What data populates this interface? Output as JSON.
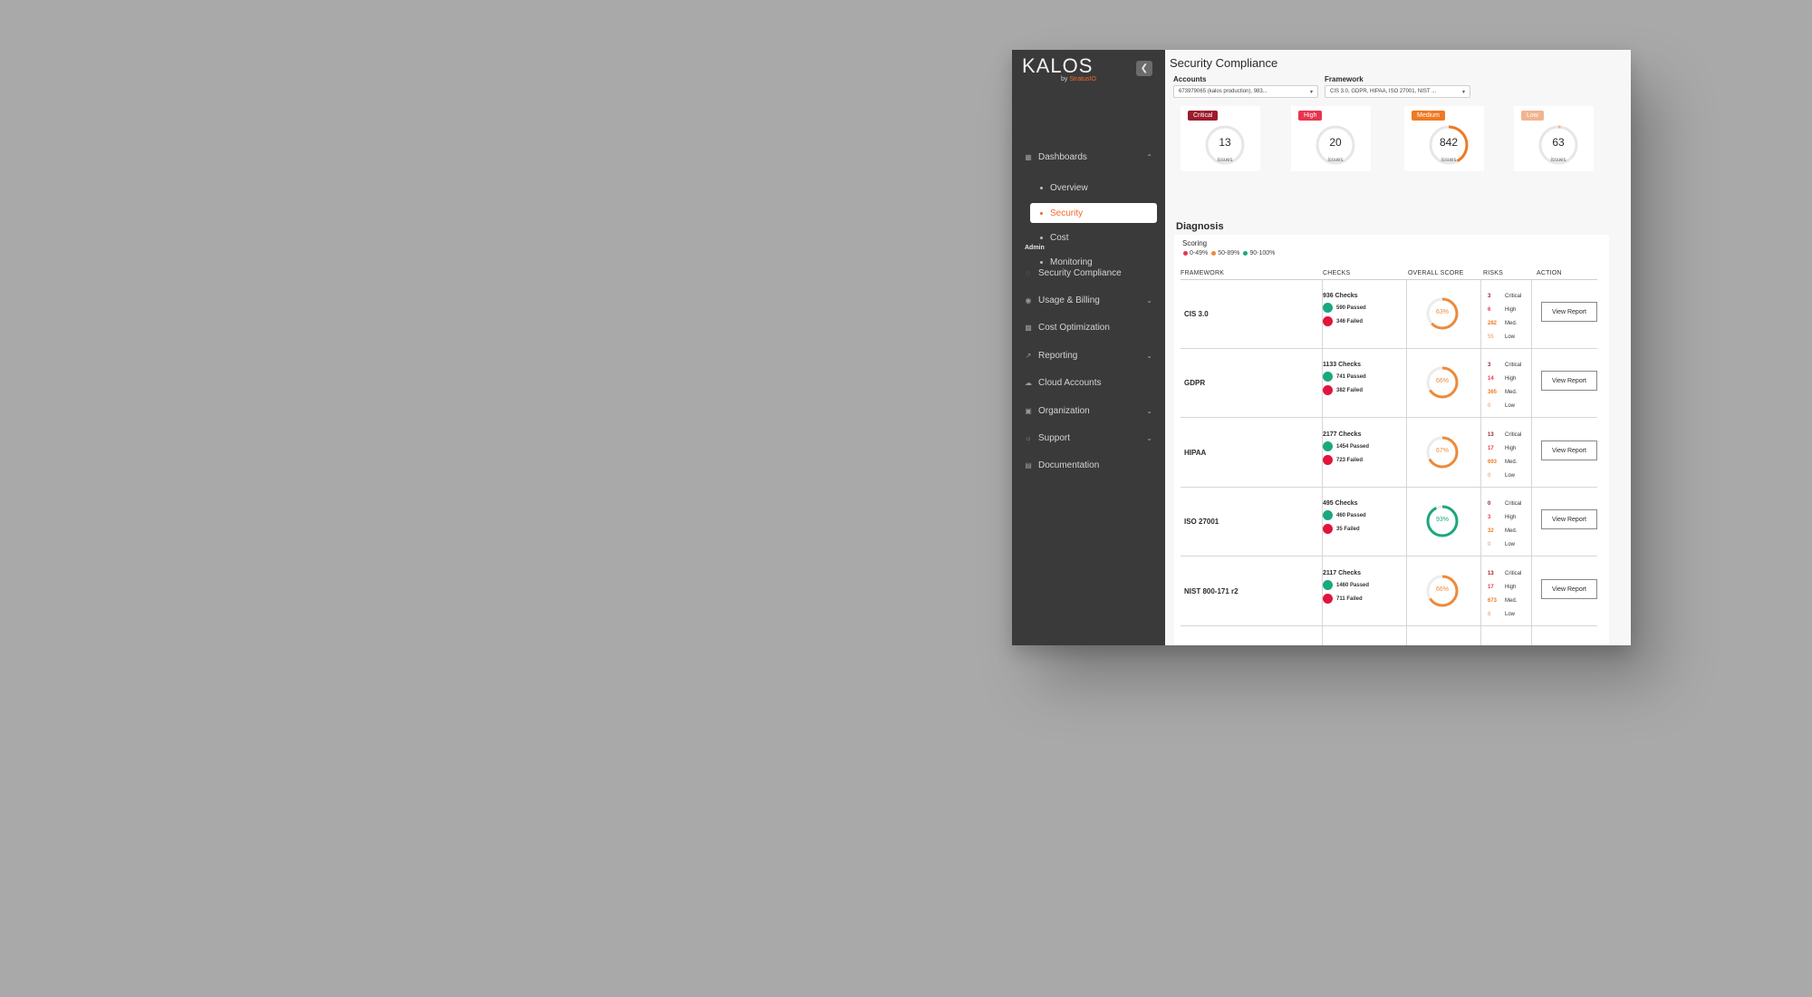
{
  "sidebar": {
    "logo": "KALOS",
    "logo_sub_prefix": "by ",
    "logo_sub_brand": "StratusIO",
    "dashboards_label": "Dashboards",
    "dashboard_items": [
      {
        "label": "Overview"
      },
      {
        "label": "Security"
      },
      {
        "label": "Cost"
      },
      {
        "label": "Monitoring"
      }
    ],
    "admin_label": "Admin",
    "admin_items": [
      {
        "label": "Security Compliance"
      },
      {
        "label": "Usage & Billing"
      },
      {
        "label": "Cost Optimization"
      },
      {
        "label": "Reporting"
      },
      {
        "label": "Cloud Accounts"
      },
      {
        "label": "Organization"
      },
      {
        "label": "Support"
      },
      {
        "label": "Documentation"
      }
    ]
  },
  "page": {
    "title": "Security Compliance",
    "accounts_label": "Accounts",
    "accounts_value": "673979065   (kalos production), 983...",
    "framework_label": "Framework",
    "framework_value": "CIS 3.0, GDPR, HIPAA, ISO 27001, NIST ..."
  },
  "severity": [
    {
      "label": "Critical",
      "count": "13",
      "unit": "issues",
      "color": "#9b1c2b",
      "fraction": 0.0
    },
    {
      "label": "High",
      "count": "20",
      "unit": "issues",
      "color": "#e8344e",
      "fraction": 0.0
    },
    {
      "label": "Medium",
      "count": "842",
      "unit": "issues",
      "color": "#ee7a22",
      "fraction": 0.42
    },
    {
      "label": "Low",
      "count": "63",
      "unit": "issues",
      "color": "#f1b48f",
      "fraction": 0.02
    }
  ],
  "diagnosis": {
    "title": "Diagnosis",
    "scoring_title": "Scoring",
    "legend": [
      {
        "label": "0-49%",
        "color": "#e8344e"
      },
      {
        "label": "50-89%",
        "color": "#ee8a3a"
      },
      {
        "label": "90-100%",
        "color": "#1aa87e"
      }
    ],
    "columns": [
      "FRAMEWORK",
      "CHECKS",
      "OVERALL SCORE",
      "RISKS",
      "ACTION"
    ],
    "rows": [
      {
        "framework": "CIS 3.0",
        "checks": "936 Checks",
        "passed": "590 Passed",
        "failed": "346 Failed",
        "score": 63,
        "score_label": "63%",
        "critical": "3",
        "high": "6",
        "med": "282",
        "low": "55"
      },
      {
        "framework": "GDPR",
        "checks": "1133 Checks",
        "passed": "741 Passed",
        "failed": "382 Failed",
        "score": 66,
        "score_label": "66%",
        "critical": "3",
        "high": "14",
        "med": "365",
        "low": "0"
      },
      {
        "framework": "HIPAA",
        "checks": "2177 Checks",
        "passed": "1454 Passed",
        "failed": "723 Failed",
        "score": 67,
        "score_label": "67%",
        "critical": "13",
        "high": "17",
        "med": "693",
        "low": "0"
      },
      {
        "framework": "ISO 27001",
        "checks": "495 Checks",
        "passed": "460 Passed",
        "failed": "35 Failed",
        "score": 93,
        "score_label": "93%",
        "critical": "0",
        "high": "3",
        "med": "32",
        "low": "0"
      },
      {
        "framework": "NIST 800-171 r2",
        "checks": "2117 Checks",
        "passed": "1460 Passed",
        "failed": "711 Failed",
        "score": 66,
        "score_label": "66%",
        "critical": "13",
        "high": "17",
        "med": "673",
        "low": "8"
      }
    ],
    "risk_labels": {
      "critical": "Critical",
      "high": "High",
      "med": "Med.",
      "low": "Low"
    },
    "action_label": "View Report"
  },
  "colors": {
    "critical": "#9b1c2b",
    "high": "#e8344e",
    "medium": "#ee7a22",
    "low": "#f1b48f",
    "passed": "#1aa87e",
    "failed": "#e0143c",
    "accent": "#f26a2a"
  }
}
